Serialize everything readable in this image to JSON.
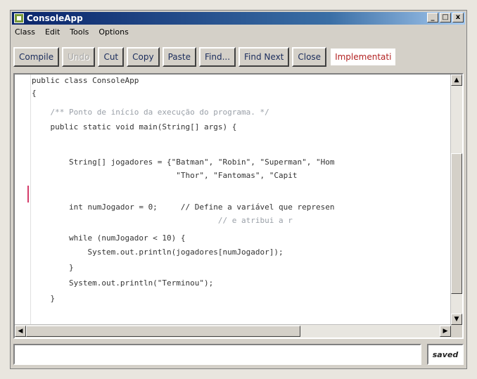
{
  "window": {
    "title": "ConsoleApp",
    "controls": [
      "_",
      "□",
      "x"
    ]
  },
  "menu": [
    "Class",
    "Edit",
    "Tools",
    "Options"
  ],
  "toolbar": {
    "compile": "Compile",
    "undo": "Undo",
    "cut": "Cut",
    "copy": "Copy",
    "paste": "Paste",
    "find": "Find...",
    "find_next": "Find Next",
    "close": "Close",
    "view_mode": "Implementati"
  },
  "editor": {
    "lines": [
      "public class ConsoleApp",
      "{",
      "    /** Ponto de início da execução do programa. */",
      "    public static void main(String[] args) {",
      "",
      "        String[] jogadores = {\"Batman\", \"Robin\", \"Superman\", \"Hom",
      "                               \"Thor\", \"Fantomas\", \"Capit",
      "",
      "        int numJogador = 0;     // Define a variável que represen",
      "                                        // e atribui a r",
      "        while (numJogador < 10) {",
      "            System.out.println(jogadores[numJogador]);",
      "        }",
      "        System.out.println(\"Terminou\");",
      "    }"
    ]
  },
  "statusbar": {
    "message": "",
    "saved_label": "saved"
  }
}
